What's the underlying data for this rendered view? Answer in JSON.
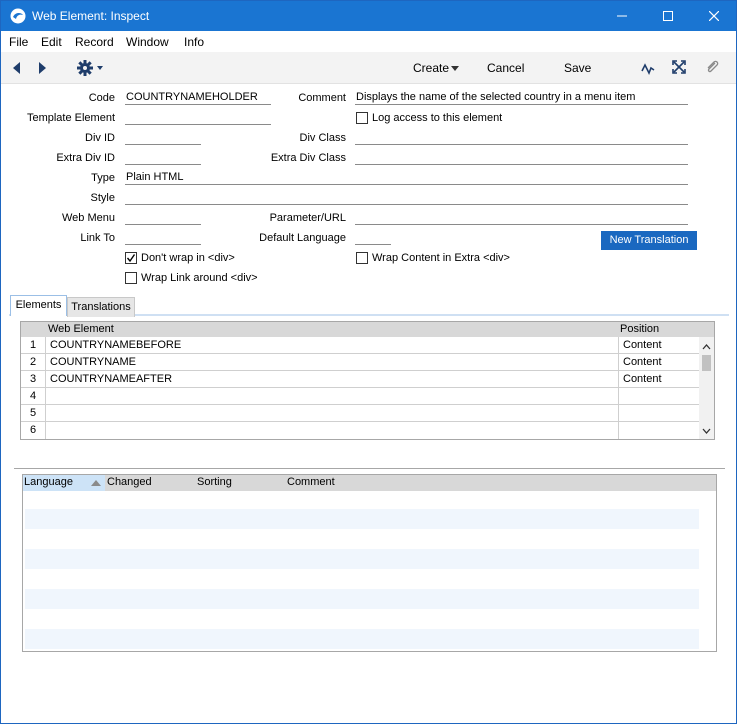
{
  "window": {
    "title": "Web Element: Inspect",
    "colors": {
      "titlebar": "#1a75d2",
      "accent_button": "#1a68c0"
    }
  },
  "menu": [
    "File",
    "Edit",
    "Record",
    "Window",
    "Info"
  ],
  "toolbar": {
    "create_label": "Create",
    "cancel_label": "Cancel",
    "save_label": "Save"
  },
  "form": {
    "code_label": "Code",
    "code_value": "COUNTRYNAMEHOLDER",
    "comment_label": "Comment",
    "comment_value": "Displays the name of the selected country in a menu item",
    "template_label": "Template Element",
    "template_value": "",
    "log_access_label": "Log access to this element",
    "log_access_checked": false,
    "divid_label": "Div ID",
    "divid_value": "",
    "divclass_label": "Div Class",
    "divclass_value": "",
    "extradivid_label": "Extra Div ID",
    "extradivid_value": "",
    "extradivclass_label": "Extra Div Class",
    "extradivclass_value": "",
    "type_label": "Type",
    "type_value": "Plain HTML",
    "style_label": "Style",
    "style_value": "",
    "webmenu_label": "Web Menu",
    "webmenu_value": "",
    "param_label": "Parameter/URL",
    "param_value": "",
    "linkto_label": "Link To",
    "linkto_value": "",
    "deflang_label": "Default Language",
    "deflang_value": "",
    "new_translation_label": "New Translation",
    "dont_wrap_label": "Don't wrap in <div>",
    "dont_wrap_checked": true,
    "wrap_content_label": "Wrap Content in Extra <div>",
    "wrap_content_checked": false,
    "wrap_link_label": "Wrap Link around <div>",
    "wrap_link_checked": false
  },
  "tabs": [
    {
      "label": "Elements",
      "active": true
    },
    {
      "label": "Translations",
      "active": false
    }
  ],
  "elements_grid": {
    "headers": [
      "Web Element",
      "Position"
    ],
    "rows": [
      {
        "num": "1",
        "element": "COUNTRYNAMEBEFORE",
        "position": "Content"
      },
      {
        "num": "2",
        "element": "COUNTRYNAME",
        "position": "Content"
      },
      {
        "num": "3",
        "element": "COUNTRYNAMEAFTER",
        "position": "Content"
      },
      {
        "num": "4",
        "element": "",
        "position": ""
      },
      {
        "num": "5",
        "element": "",
        "position": ""
      },
      {
        "num": "6",
        "element": "",
        "position": ""
      }
    ]
  },
  "translations_grid": {
    "headers": [
      "Language",
      "Changed",
      "Sorting",
      "Comment"
    ]
  }
}
